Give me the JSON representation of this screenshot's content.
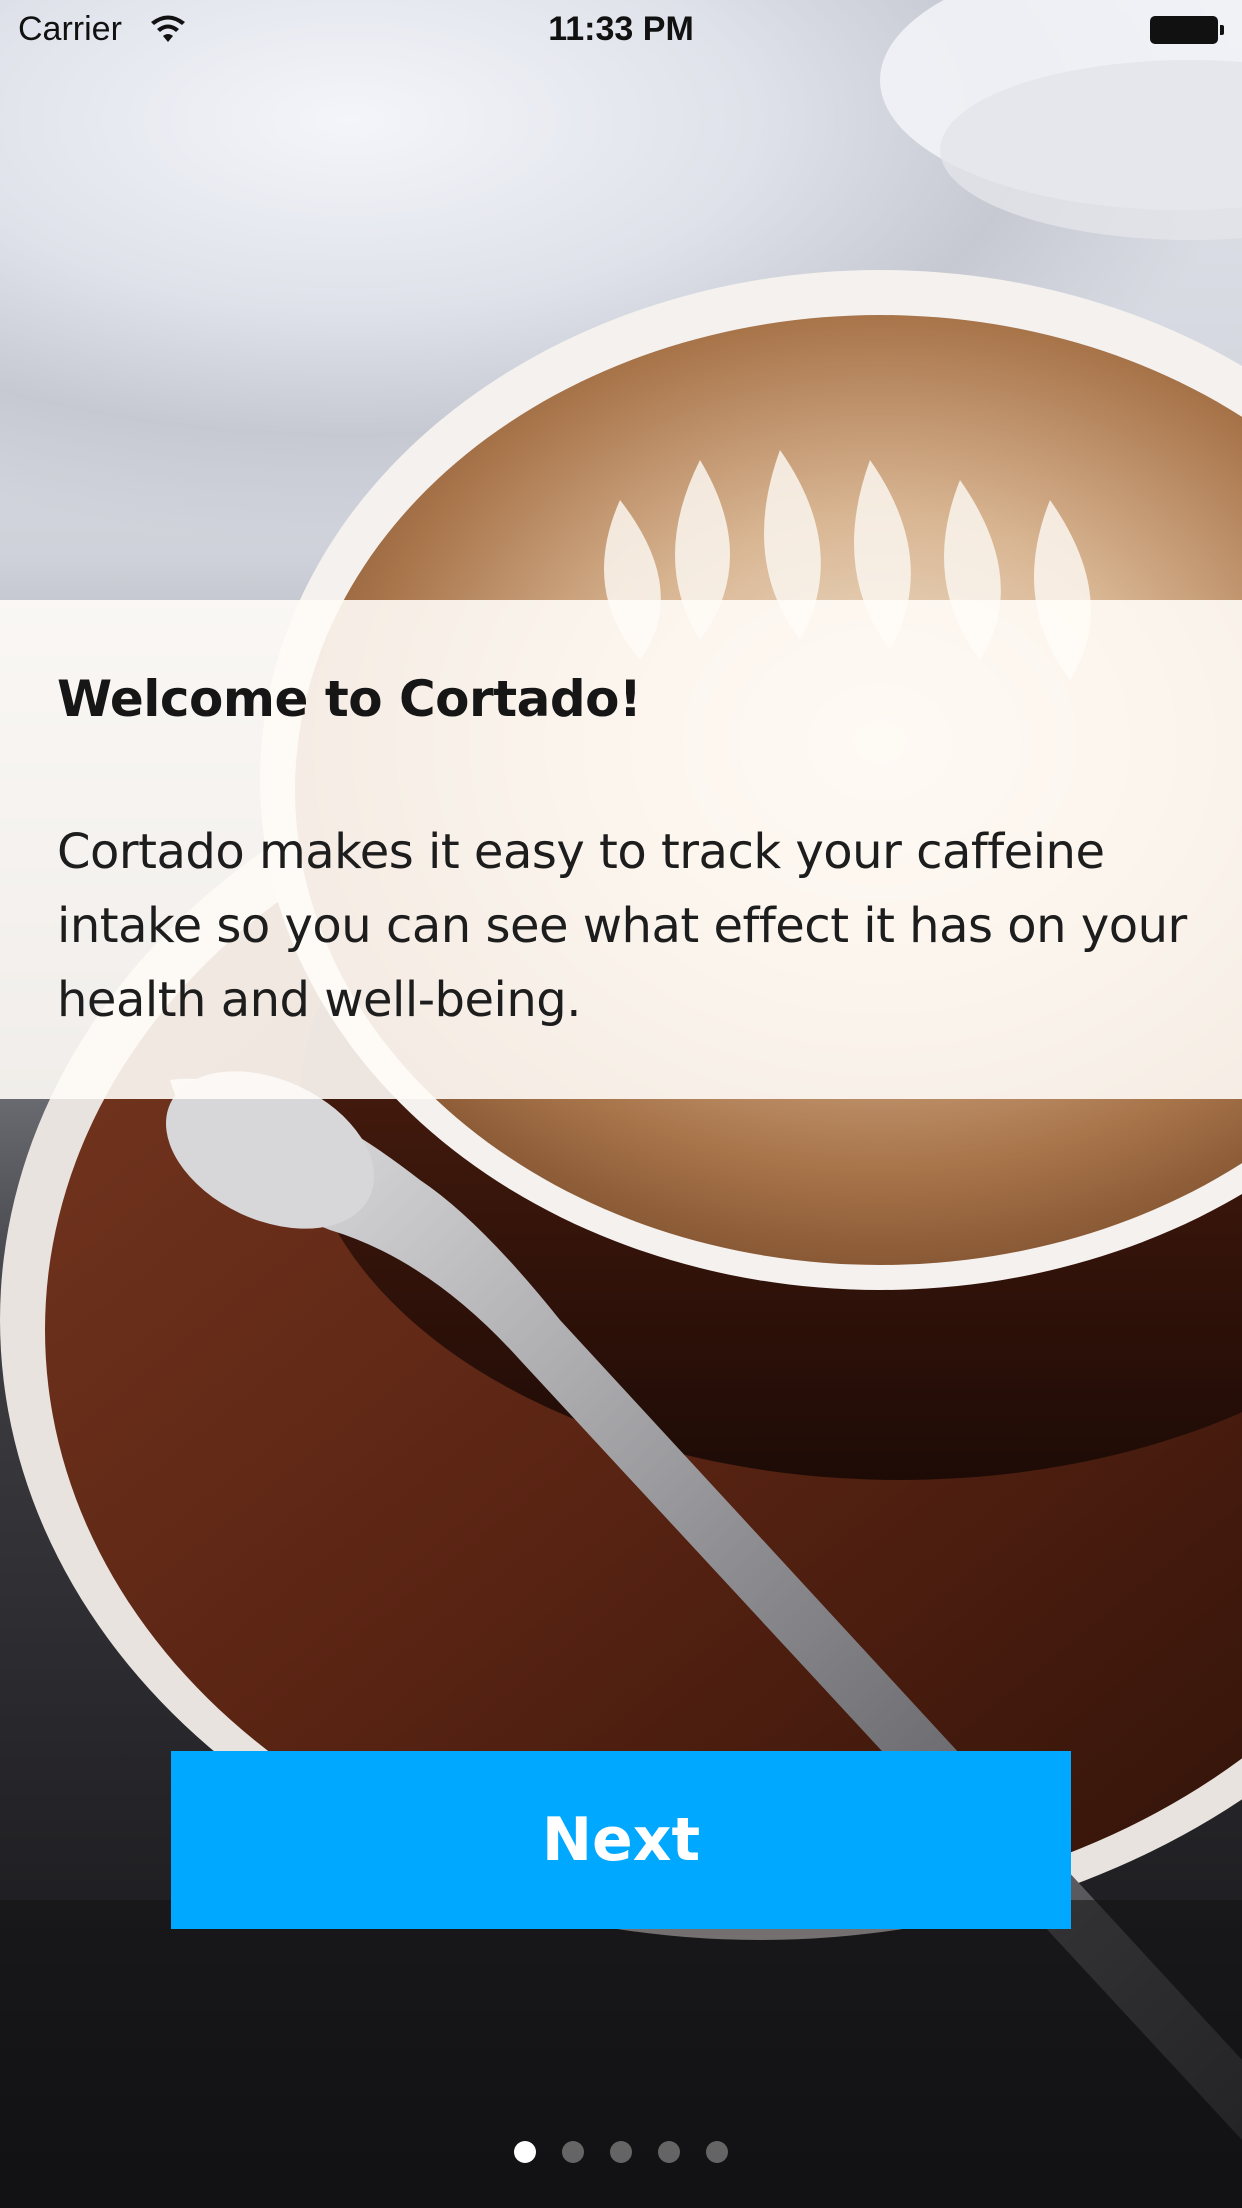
{
  "status_bar": {
    "carrier": "Carrier",
    "time": "11:33 PM",
    "wifi_icon": "wifi-icon",
    "battery_icon": "battery-icon"
  },
  "onboarding": {
    "title": "Welcome to Cortado!",
    "body": "Cortado makes it easy to track your caffeine intake so you can see what effect it has on your health and well-being.",
    "background_image": "coffee-cup-latte-art-photo"
  },
  "next_button": {
    "label": "Next",
    "color": "#00a9ff"
  },
  "page_indicator": {
    "total_pages": 5,
    "current_page": 1
  }
}
